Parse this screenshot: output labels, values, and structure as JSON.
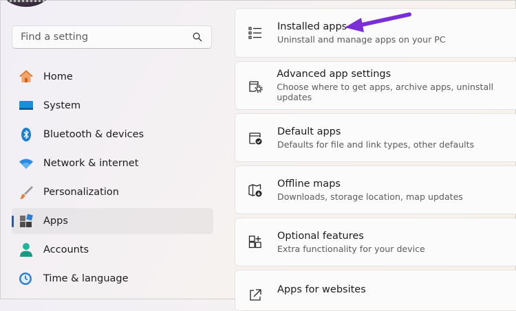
{
  "search": {
    "placeholder": "Find a setting"
  },
  "nav": {
    "items": [
      {
        "label": "Home",
        "icon": "home-icon"
      },
      {
        "label": "System",
        "icon": "system-icon"
      },
      {
        "label": "Bluetooth & devices",
        "icon": "bluetooth-icon"
      },
      {
        "label": "Network & internet",
        "icon": "wifi-icon"
      },
      {
        "label": "Personalization",
        "icon": "brush-icon"
      },
      {
        "label": "Apps",
        "icon": "apps-icon",
        "selected": true
      },
      {
        "label": "Accounts",
        "icon": "person-icon"
      },
      {
        "label": "Time & language",
        "icon": "clock-globe-icon"
      }
    ]
  },
  "cards": [
    {
      "title": "Installed apps",
      "subtitle": "Uninstall and manage apps on your PC",
      "icon": "list-icon"
    },
    {
      "title": "Advanced app settings",
      "subtitle": "Choose where to get apps, archive apps, uninstall updates",
      "icon": "app-settings-icon"
    },
    {
      "title": "Default apps",
      "subtitle": "Defaults for file and link types, other defaults",
      "icon": "default-apps-icon"
    },
    {
      "title": "Offline maps",
      "subtitle": "Downloads, storage location, map updates",
      "icon": "map-download-icon"
    },
    {
      "title": "Optional features",
      "subtitle": "Extra functionality for your device",
      "icon": "optional-features-icon"
    },
    {
      "title": "Apps for websites",
      "subtitle": "",
      "icon": "open-external-icon"
    }
  ],
  "colors": {
    "accent": "#2b57a8",
    "annotation_arrow": "#7a2fd6"
  }
}
